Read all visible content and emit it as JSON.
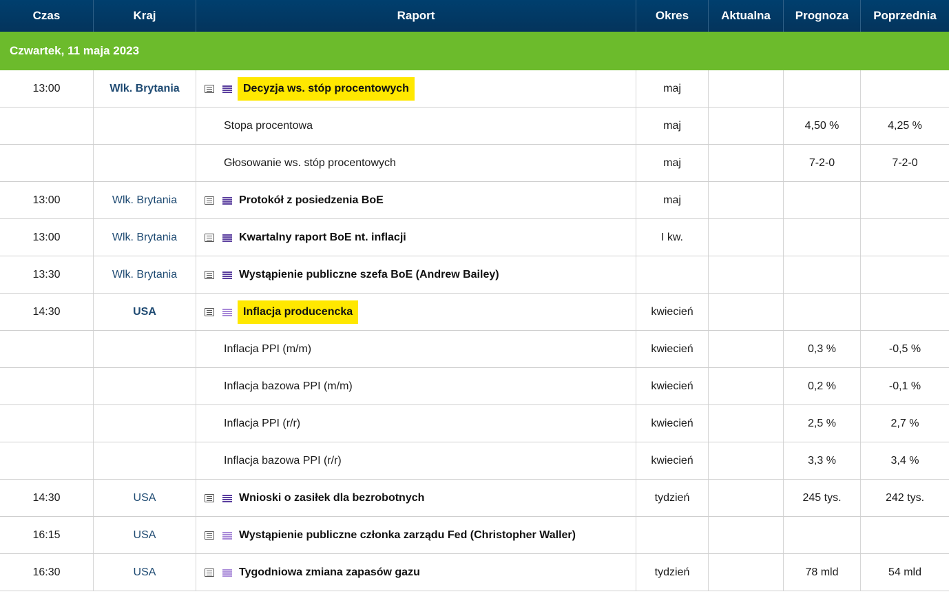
{
  "headers": {
    "time": "Czas",
    "country": "Kraj",
    "report": "Raport",
    "period": "Okres",
    "actual": "Aktualna",
    "forecast": "Prognoza",
    "previous": "Poprzednia"
  },
  "day": "Czwartek, 11 maja 2023",
  "rows": [
    {
      "time": "13:00",
      "country": "Wlk. Brytania",
      "report": "Decyzja ws. stóp procentowych",
      "period": "maj",
      "actual": "",
      "forecast": "",
      "previous": ""
    },
    {
      "time": "",
      "country": "",
      "report": "Stopa procentowa",
      "period": "maj",
      "actual": "",
      "forecast": "4,50 %",
      "previous": "4,25 %"
    },
    {
      "time": "",
      "country": "",
      "report": "Głosowanie ws. stóp procentowych",
      "period": "maj",
      "actual": "",
      "forecast": "7-2-0",
      "previous": "7-2-0"
    },
    {
      "time": "13:00",
      "country": "Wlk. Brytania",
      "report": "Protokół z posiedzenia BoE",
      "period": "maj",
      "actual": "",
      "forecast": "",
      "previous": ""
    },
    {
      "time": "13:00",
      "country": "Wlk. Brytania",
      "report": "Kwartalny raport BoE nt. inflacji",
      "period": "I kw.",
      "actual": "",
      "forecast": "",
      "previous": ""
    },
    {
      "time": "13:30",
      "country": "Wlk. Brytania",
      "report": "Wystąpienie publiczne szefa BoE (Andrew Bailey)",
      "period": "",
      "actual": "",
      "forecast": "",
      "previous": ""
    },
    {
      "time": "14:30",
      "country": "USA",
      "report": "Inflacja producencka",
      "period": "kwiecień",
      "actual": "",
      "forecast": "",
      "previous": ""
    },
    {
      "time": "",
      "country": "",
      "report": "Inflacja PPI (m/m)",
      "period": "kwiecień",
      "actual": "",
      "forecast": "0,3 %",
      "previous": "-0,5 %"
    },
    {
      "time": "",
      "country": "",
      "report": "Inflacja bazowa PPI (m/m)",
      "period": "kwiecień",
      "actual": "",
      "forecast": "0,2 %",
      "previous": "-0,1 %"
    },
    {
      "time": "",
      "country": "",
      "report": "Inflacja PPI (r/r)",
      "period": "kwiecień",
      "actual": "",
      "forecast": "2,5 %",
      "previous": "2,7 %"
    },
    {
      "time": "",
      "country": "",
      "report": "Inflacja bazowa PPI (r/r)",
      "period": "kwiecień",
      "actual": "",
      "forecast": "3,3 %",
      "previous": "3,4 %"
    },
    {
      "time": "14:30",
      "country": "USA",
      "report": "Wnioski o zasiłek dla bezrobotnych",
      "period": "tydzień",
      "actual": "",
      "forecast": "245 tys.",
      "previous": "242 tys."
    },
    {
      "time": "16:15",
      "country": "USA",
      "report": "Wystąpienie publiczne członka zarządu Fed (Christopher Waller)",
      "period": "",
      "actual": "",
      "forecast": "",
      "previous": ""
    },
    {
      "time": "16:30",
      "country": "USA",
      "report": "Tygodniowa zmiana zapasów gazu",
      "period": "tydzień",
      "actual": "",
      "forecast": "78 mld",
      "previous": "54 mld"
    }
  ],
  "colors": {
    "header_bg": "#04345c",
    "day_bg": "#6cbb2c",
    "highlight": "#ffe800",
    "country_text": "#1e4a72",
    "importance_high": "#5a3e9e",
    "importance_mid": "#a889d8"
  },
  "icons": {
    "detail": "document-list-icon",
    "importance": "importance-bars-icon"
  }
}
